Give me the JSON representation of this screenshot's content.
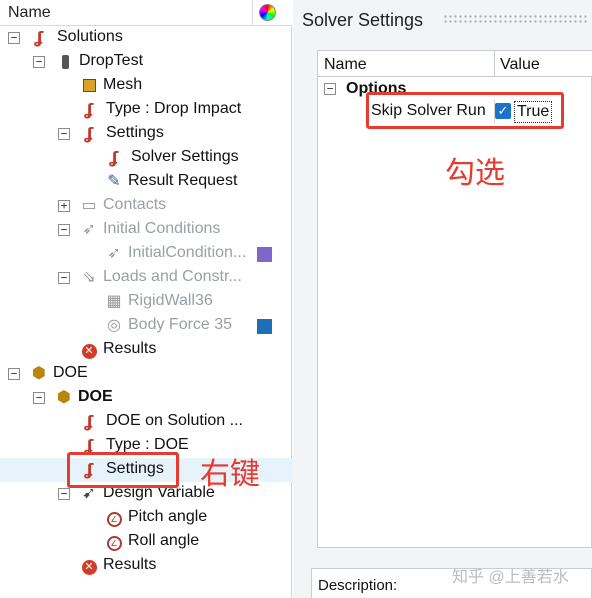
{
  "tree": {
    "header": {
      "name_label": "Name",
      "color_wheel_icon": "color-wheel-icon"
    },
    "items": [
      {
        "label": "Solutions",
        "icon": "solver-icon",
        "toggle": "−"
      },
      {
        "label": "DropTest",
        "icon": "bottle-icon",
        "toggle": "−"
      },
      {
        "label": "Mesh",
        "icon": "mesh-icon"
      },
      {
        "label": "Type : Drop Impact",
        "icon": "solver-icon"
      },
      {
        "label": "Settings",
        "icon": "solver-icon",
        "toggle": "−"
      },
      {
        "label": "Solver Settings",
        "icon": "solver-icon"
      },
      {
        "label": "Result Request",
        "icon": "result-request-icon"
      },
      {
        "label": "Contacts",
        "icon": "contacts-icon",
        "toggle": "+",
        "disabled": true
      },
      {
        "label": "Initial Conditions",
        "icon": "initial-conditions-icon",
        "toggle": "−",
        "disabled": true
      },
      {
        "label": "InitialCondition...",
        "icon": "initial-condition-icon",
        "disabled": true,
        "swatch": "#7f66cc"
      },
      {
        "label": "Loads and Constr...",
        "icon": "loads-icon",
        "toggle": "−",
        "disabled": true
      },
      {
        "label": "RigidWall36",
        "icon": "rigid-wall-icon",
        "disabled": true
      },
      {
        "label": "Body Force 35",
        "icon": "body-force-icon",
        "disabled": true,
        "swatch": "#1f6fb8"
      },
      {
        "label": "Results",
        "icon": "error-icon"
      },
      {
        "label": "DOE",
        "icon": "doe-icon",
        "toggle": "−"
      },
      {
        "label": "DOE",
        "icon": "doe-icon",
        "toggle": "−",
        "bold": true
      },
      {
        "label": "DOE on Solution ...",
        "icon": "solver-icon"
      },
      {
        "label": "Type : DOE",
        "icon": "solver-icon"
      },
      {
        "label": "Settings",
        "icon": "solver-icon",
        "highlighted": true
      },
      {
        "label": "Design Variable",
        "icon": "design-variable-icon",
        "toggle": "−"
      },
      {
        "label": "Pitch angle",
        "icon": "angle-icon"
      },
      {
        "label": "Roll angle",
        "icon": "angle-icon"
      },
      {
        "label": "Results",
        "icon": "error-icon"
      }
    ]
  },
  "annotations": {
    "right_click": "右键",
    "check": "勾选",
    "accent": "#e53b30"
  },
  "panel": {
    "title": "Solver Settings",
    "grid": {
      "col_name": "Name",
      "col_value": "Value",
      "group_toggle": "−",
      "group_label": "Options",
      "row_label": "Skip Solver Run",
      "row_checked": true,
      "row_value": "True"
    },
    "description_label": "Description:"
  },
  "watermark": "知乎 @上善若水"
}
